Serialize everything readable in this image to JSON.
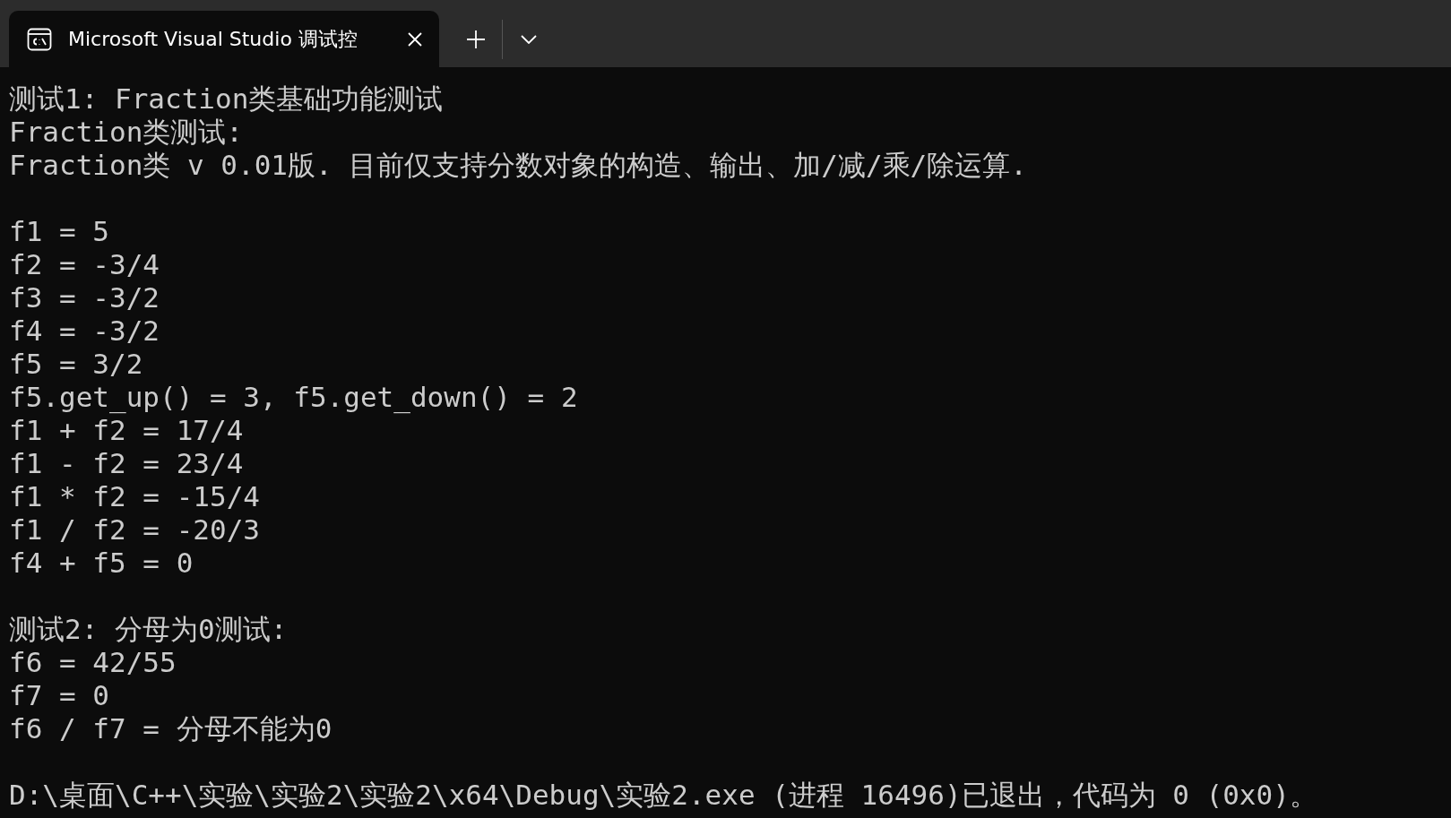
{
  "window": {
    "tabs": [
      {
        "title": "Microsoft Visual Studio 调试控",
        "selected": true
      }
    ]
  },
  "console": {
    "blocks": [
      [
        "测试1: Fraction类基础功能测试",
        "Fraction类测试:",
        "Fraction类 v 0.01版. 目前仅支持分数对象的构造、输出、加/减/乘/除运算."
      ],
      [
        "f1 = 5",
        "f2 = -3/4",
        "f3 = -3/2",
        "f4 = -3/2",
        "f5 = 3/2",
        "f5.get_up() = 3, f5.get_down() = 2",
        "f1 + f2 = 17/4",
        "f1 - f2 = 23/4",
        "f1 * f2 = -15/4",
        "f1 / f2 = -20/3",
        "f4 + f5 = 0"
      ],
      [
        "测试2: 分母为0测试:",
        "f6 = 42/55",
        "f7 = 0",
        "f6 / f7 = 分母不能为0"
      ],
      [
        "D:\\桌面\\C++\\实验\\实验2\\实验2\\x64\\Debug\\实验2.exe (进程 16496)已退出，代码为 0 (0x0)。"
      ]
    ]
  }
}
